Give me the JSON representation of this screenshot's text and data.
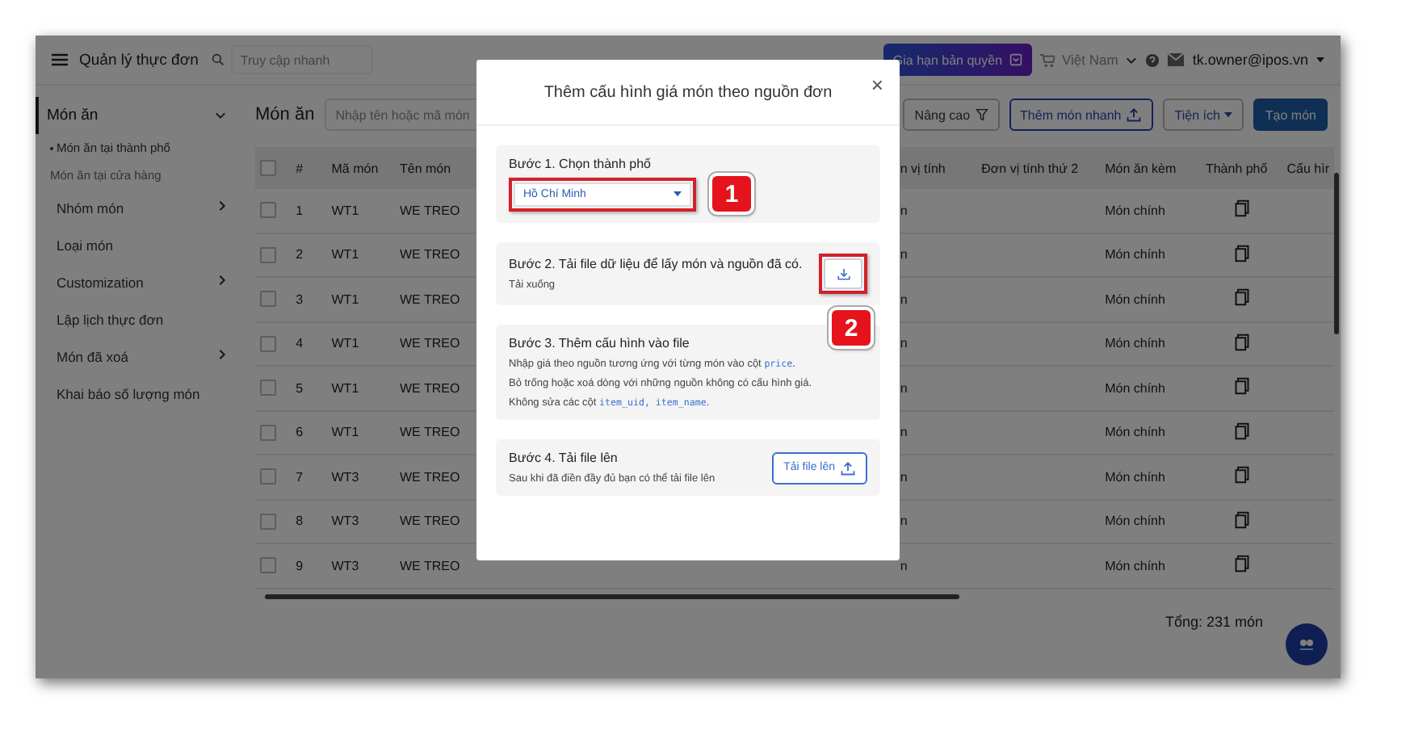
{
  "header": {
    "menu_title": "Quản lý thực đơn",
    "search": {
      "placeholder": "Truy cập nhanh"
    },
    "license_button": "Gia hạn bản quyền",
    "country": "Việt Nam",
    "account": "tk.owner@ipos.vn"
  },
  "sidebar": {
    "items": [
      {
        "label": "Món ăn",
        "selected": true,
        "expanded": true,
        "children": [
          {
            "label": "Món ăn tại thành phố",
            "selected": true
          },
          {
            "label": "Món ăn tại cửa hàng",
            "selected": false
          }
        ]
      },
      {
        "label": "Nhóm món",
        "selected": false,
        "expanded": false
      },
      {
        "label": "Loại món",
        "selected": false
      },
      {
        "label": "Customization",
        "selected": false,
        "expanded": false
      },
      {
        "label": "Lập lịch thực đơn",
        "selected": false
      },
      {
        "label": "Món đã xoá",
        "selected": false,
        "expanded": false
      },
      {
        "label": "Khai báo số lượng món",
        "selected": false
      }
    ]
  },
  "toolbar": {
    "title": "Món ăn",
    "search": {
      "placeholder": "Nhập tên hoặc mã món"
    },
    "buttons": [
      {
        "label": "Nâng cao",
        "kind": "filter"
      },
      {
        "label": "Thêm món nhanh",
        "kind": "upload"
      },
      {
        "label": "Tiện ích",
        "kind": "dropdown"
      },
      {
        "label": "Tạo món",
        "kind": "primary"
      }
    ]
  },
  "table": {
    "all_checked": false,
    "columns": [
      "#",
      "Mã món",
      "Tên món",
      "n vị tính",
      "Đơn vị tính thứ 2",
      "Món ăn kèm",
      "Thành phố",
      "Cấu hìr"
    ],
    "rows": [
      {
        "checked": false,
        "no": "1",
        "code": "WT1",
        "name": "WE TREO",
        "unit": "n",
        "side": "Món chính"
      },
      {
        "checked": false,
        "no": "2",
        "code": "WT1",
        "name": "WE TREO",
        "unit": "n",
        "side": "Món chính"
      },
      {
        "checked": false,
        "no": "3",
        "code": "WT1",
        "name": "WE TREO",
        "unit": "n",
        "side": "Món chính"
      },
      {
        "checked": false,
        "no": "4",
        "code": "WT1",
        "name": "WE TREO",
        "unit": "n",
        "side": "Món chính"
      },
      {
        "checked": false,
        "no": "5",
        "code": "WT1",
        "name": "WE TREO",
        "unit": "n",
        "side": "Món chính"
      },
      {
        "checked": false,
        "no": "6",
        "code": "WT1",
        "name": "WE TREO",
        "unit": "n",
        "side": "Món chính"
      },
      {
        "checked": false,
        "no": "7",
        "code": "WT3",
        "name": "WE TREO",
        "unit": "n",
        "side": "Món chính"
      },
      {
        "checked": false,
        "no": "8",
        "code": "WT3",
        "name": "WE TREO",
        "unit": "n",
        "side": "Món chính"
      },
      {
        "checked": false,
        "no": "9",
        "code": "WT3",
        "name": "WE TREO",
        "unit": "n",
        "side": "Món chính"
      }
    ],
    "total": "Tổng: 231 món"
  },
  "modal": {
    "title": "Thêm cấu hình giá món theo nguồn đơn",
    "close": "×",
    "steps": [
      {
        "kind": "select",
        "title": "Bước 1. Chọn thành phố",
        "value": "Hồ Chí Minh",
        "callout": "1"
      },
      {
        "kind": "download",
        "title": "Bước 2. Tải file dữ liệu để lấy món và nguồn đã có.",
        "lines": [
          [
            {
              "kind": "text",
              "text": "Tải xuống"
            }
          ]
        ],
        "callout": "2"
      },
      {
        "kind": "info",
        "title": "Bước 3. Thêm cấu hình vào file",
        "lines": [
          [
            {
              "kind": "text",
              "text": "Nhập giá theo nguồn tương ứng với từng món vào cột "
            },
            {
              "kind": "code",
              "text": "price"
            },
            {
              "kind": "text",
              "text": "."
            }
          ],
          [
            {
              "kind": "text",
              "text": "Bỏ trống hoặc xoá dòng với những nguồn không có cấu hình giá."
            }
          ],
          [
            {
              "kind": "text",
              "text": "Không sửa các cột "
            },
            {
              "kind": "code",
              "text": "item_uid, item_name"
            },
            {
              "kind": "text",
              "text": "."
            }
          ]
        ]
      },
      {
        "kind": "upload",
        "title": "Bước 4. Tải file lên",
        "lines": [
          [
            {
              "kind": "text",
              "text": "Sau khi đã điền đầy đủ bạn có thể tải file lên"
            }
          ]
        ],
        "button": "Tải file lên"
      }
    ]
  }
}
